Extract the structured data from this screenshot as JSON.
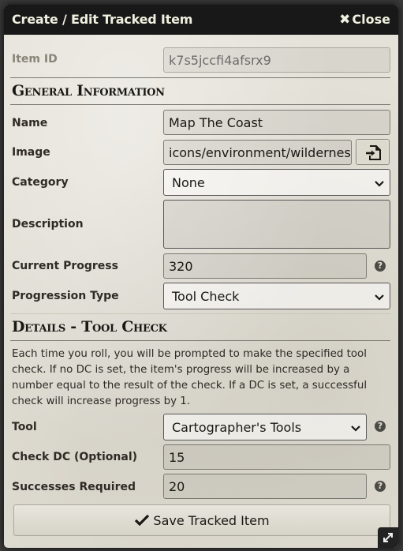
{
  "window": {
    "title": "Create / Edit Tracked Item",
    "close_label": "Close"
  },
  "item_id": {
    "label": "Item ID",
    "value": "k7s5jccfi4afsrx9"
  },
  "general": {
    "header": "General Information",
    "name": {
      "label": "Name",
      "value": "Map The Coast"
    },
    "image": {
      "label": "Image",
      "value": "icons/environment/wilderness"
    },
    "category": {
      "label": "Category",
      "value": "None"
    },
    "description": {
      "label": "Description",
      "value": ""
    },
    "current_progress": {
      "label": "Current Progress",
      "value": "320"
    },
    "progression_type": {
      "label": "Progression Type",
      "value": "Tool Check"
    }
  },
  "details": {
    "header": "Details - Tool Check",
    "note": "Each time you roll, you will be prompted to make the specified tool check. If no DC is set, the item's progress will be increased by a number equal to the result of the check. If a DC is set, a successful check will increase progress by 1.",
    "tool": {
      "label": "Tool",
      "value": "Cartographer's Tools"
    },
    "check_dc": {
      "label": "Check DC (Optional)",
      "value": "15"
    },
    "successes": {
      "label": "Successes Required",
      "value": "20"
    }
  },
  "save_label": "Save Tracked Item",
  "icons": {
    "close": "close-x-icon",
    "file_picker": "file-import-icon",
    "help": "question-circle-icon",
    "chevron": "chevron-down-icon",
    "check": "check-icon",
    "resize": "resize-icon"
  }
}
